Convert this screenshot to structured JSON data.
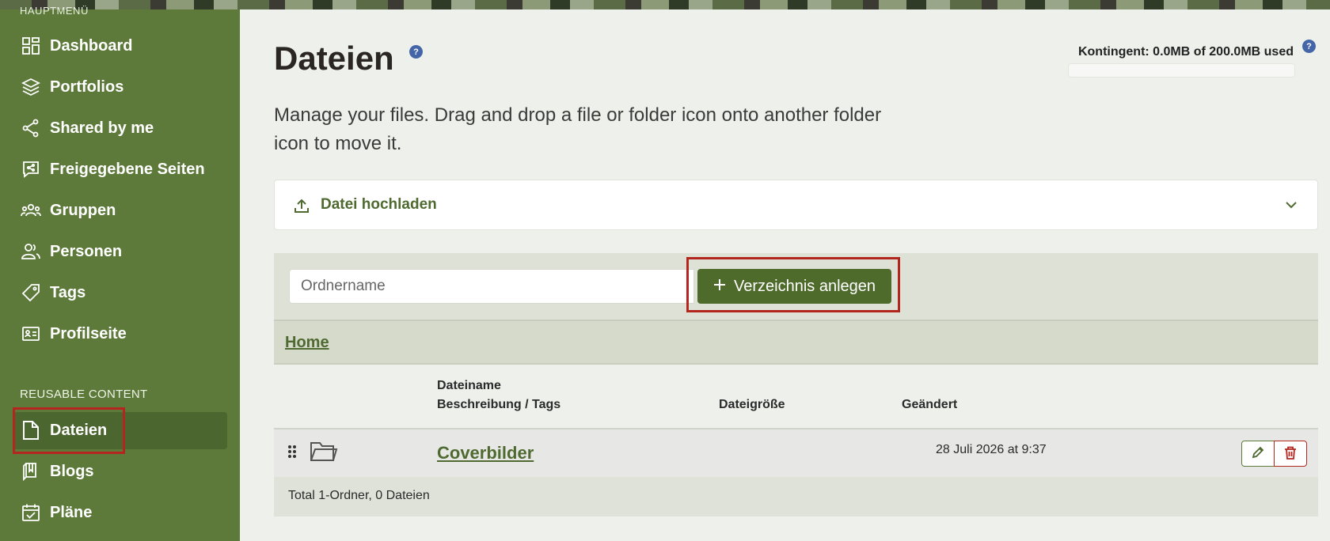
{
  "sidebar": {
    "cut_heading": "HAUPTMENÜ",
    "items": [
      {
        "label": "Dashboard",
        "icon": "dashboard-icon"
      },
      {
        "label": "Portfolios",
        "icon": "layers-icon"
      },
      {
        "label": "Shared by me",
        "icon": "share-icon"
      },
      {
        "label": "Freigegebene Seiten",
        "icon": "shared-pages-icon"
      },
      {
        "label": "Gruppen",
        "icon": "groups-icon"
      },
      {
        "label": "Personen",
        "icon": "people-icon"
      },
      {
        "label": "Tags",
        "icon": "tag-icon"
      },
      {
        "label": "Profilseite",
        "icon": "profile-card-icon"
      }
    ],
    "section_label": "REUSABLE CONTENT",
    "reusable_items": [
      {
        "label": "Dateien",
        "icon": "file-icon",
        "active": true
      },
      {
        "label": "Blogs",
        "icon": "blog-icon"
      },
      {
        "label": "Pläne",
        "icon": "calendar-check-icon"
      }
    ]
  },
  "main": {
    "title": "Dateien",
    "help": "?",
    "quota": "Kontingent: 0.0MB of 200.0MB used",
    "quota_used_fraction": 0.0,
    "description": "Manage your files. Drag and drop a file or folder icon onto another folder icon to move it.",
    "upload_label": "Datei hochladen",
    "folder_placeholder": "Ordnername",
    "create_button": "Verzeichnis anlegen",
    "breadcrumb": "Home",
    "columns": {
      "name": "Dateiname",
      "desc_tags": "Beschreibung / Tags",
      "size": "Dateigröße",
      "modified": "Geändert"
    },
    "rows": [
      {
        "name": "Coverbilder",
        "size": "",
        "modified": "28 Juli 2026 at 9:37"
      }
    ],
    "total": "Total 1-Ordner, 0 Dateien"
  },
  "colors": {
    "sidebar": "#5d7a3a",
    "accent": "#4e6b2c",
    "highlight": "#b3261e"
  }
}
